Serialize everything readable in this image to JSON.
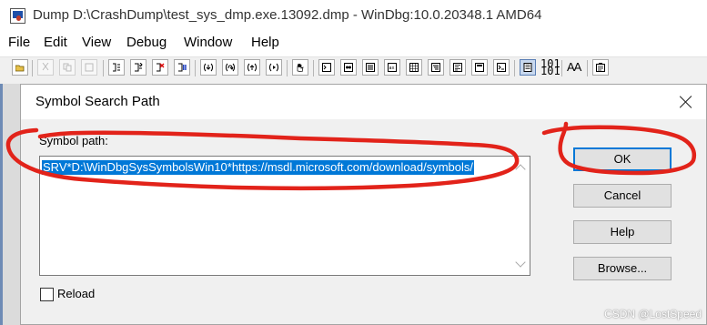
{
  "window": {
    "title": "Dump D:\\CrashDump\\test_sys_dmp.exe.13092.dmp - WinDbg:10.0.20348.1 AMD64"
  },
  "menu": [
    "File",
    "Edit",
    "View",
    "Debug",
    "Window",
    "Help"
  ],
  "toolbar": {
    "hex_label_top": "101",
    "hex_label_bottom": "101",
    "font_label": "AA",
    "icons": [
      "open-icon",
      "cut-icon",
      "copy-icon",
      "paste-icon",
      "go-icon",
      "restart-icon",
      "stop-debugging-icon",
      "break-icon",
      "step-into-icon",
      "step-over-icon",
      "step-out-icon",
      "run-to-cursor-icon",
      "breakpoint-hand-icon",
      "command-window-icon",
      "watch-window-icon",
      "locals-window-icon",
      "registers-window-icon",
      "memory-window-icon",
      "call-stack-icon",
      "disassembly-icon",
      "scratch-pad-icon",
      "processes-threads-icon",
      "source-mode-icon",
      "hex-display-icon",
      "font-icon",
      "options-icon"
    ]
  },
  "dialog": {
    "title": "Symbol Search Path",
    "field_label": "Symbol path:",
    "symbol_path": "SRV*D:\\WinDbgSysSymbolsWin10*https://msdl.microsoft.com/download/symbols/",
    "buttons": {
      "ok": "OK",
      "cancel": "Cancel",
      "help": "Help",
      "browse": "Browse..."
    },
    "reload_label": "Reload",
    "reload_checked": false
  },
  "watermark": "CSDN @LostSpeed",
  "colors": {
    "selection": "#0078d7",
    "annotation": "#e2231a",
    "dialog_bg": "#f0f0f0"
  }
}
